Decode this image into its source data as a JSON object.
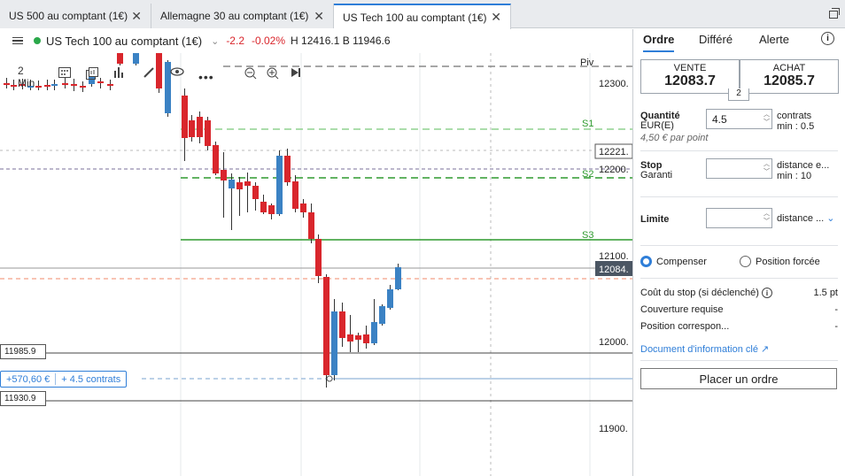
{
  "tabs": [
    {
      "label": "US 500 au comptant (1€)"
    },
    {
      "label": "Allemagne 30 au comptant (1€)"
    },
    {
      "label": "US Tech 100 au comptant (1€)"
    }
  ],
  "header": {
    "instrument": "US Tech 100 au comptant (1€)",
    "change": "-2.2",
    "change_pct": "-0.02%",
    "high_low": "H 12416.1  B 11946.6"
  },
  "toolbar": {
    "interval": "2 Min"
  },
  "chart": {
    "price_ticks": [
      "12300.",
      "12200.",
      "12100.",
      "12000.",
      "11900."
    ],
    "levels": {
      "piv": "Piv",
      "s1": "S1",
      "s2": "S2",
      "s3": "S3"
    },
    "tags": {
      "upper": "12221.",
      "current": "12084.",
      "box_high": "11985.9",
      "box_low": "11930.9"
    },
    "position": {
      "pl": "+570,60 €",
      "size": "+ 4.5 contrats"
    },
    "colors": {
      "up": "#3b82c4",
      "down": "#d9262c"
    }
  },
  "panel": {
    "tabs": {
      "ordre": "Ordre",
      "differe": "Différé",
      "alerte": "Alerte"
    },
    "sell": {
      "label": "VENTE",
      "price": "12083.7"
    },
    "buy": {
      "label": "ACHAT",
      "price": "12085.7"
    },
    "spread": "2",
    "quantity": {
      "label": "Quantité",
      "sub": "EUR(E)",
      "value": "4.5",
      "note1": "contrats",
      "note2": "min : 0.5",
      "per_point": "4,50 € par point"
    },
    "stop": {
      "label": "Stop",
      "sub": "Garanti",
      "value": "",
      "note1": "distance e...",
      "note2": "min : 10"
    },
    "limit": {
      "label": "Limite",
      "value": "",
      "note1": "distance ..."
    },
    "radio": {
      "compenser": "Compenser",
      "forcee": "Position forcée"
    },
    "info": [
      {
        "label": "Coût du stop (si déclenché)",
        "value": "1.5 pt"
      },
      {
        "label": "Couverture requise",
        "value": "-"
      },
      {
        "label": "Position correspon...",
        "value": "-"
      }
    ],
    "doc_link": "Document d'information clé",
    "place_order": "Placer un ordre"
  }
}
